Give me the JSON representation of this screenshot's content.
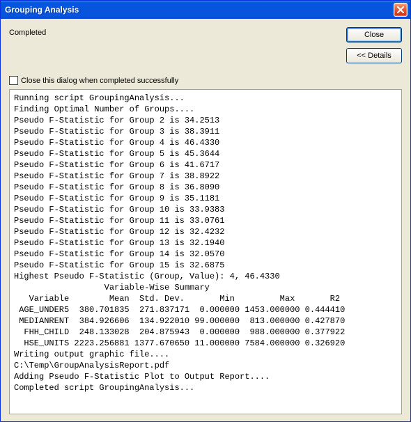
{
  "titlebar": {
    "title": "Grouping Analysis"
  },
  "status": "Completed",
  "buttons": {
    "close": "Close",
    "details": "<< Details"
  },
  "checkbox": {
    "label": "Close this dialog when completed successfully",
    "checked": false
  },
  "output_lines": [
    "Running script GroupingAnalysis...",
    "Finding Optimal Number of Groups....",
    "Pseudo F-Statistic for Group 2 is 34.2513",
    "Pseudo F-Statistic for Group 3 is 38.3911",
    "Pseudo F-Statistic for Group 4 is 46.4330",
    "Pseudo F-Statistic for Group 5 is 45.3644",
    "Pseudo F-Statistic for Group 6 is 41.6717",
    "Pseudo F-Statistic for Group 7 is 38.8922",
    "Pseudo F-Statistic for Group 8 is 36.8090",
    "Pseudo F-Statistic for Group 9 is 35.1181",
    "Pseudo F-Statistic for Group 10 is 33.9383",
    "Pseudo F-Statistic for Group 11 is 33.0761",
    "Pseudo F-Statistic for Group 12 is 32.4232",
    "Pseudo F-Statistic for Group 13 is 32.1940",
    "Pseudo F-Statistic for Group 14 is 32.0570",
    "Pseudo F-Statistic for Group 15 is 32.6875",
    "",
    "Highest Pseudo F-Statistic (Group, Value): 4, 46.4330",
    "",
    "                  Variable-Wise Summary",
    "   Variable        Mean  Std. Dev.       Min         Max       R2",
    " AGE_UNDER5  380.701835  271.837171  0.000000 1453.000000 0.444410",
    " MEDIANRENT  384.926606  134.922010 99.000000  813.000000 0.427870",
    "  FHH_CHILD  248.133028  204.875943  0.000000  988.000000 0.377922",
    "  HSE_UNITS 2223.256881 1377.670650 11.000000 7584.000000 0.326920",
    "Writing output graphic file....",
    "C:\\Temp\\GroupAnalysisReport.pdf",
    "Adding Pseudo F-Statistic Plot to Output Report....",
    "Completed script GroupingAnalysis..."
  ],
  "chart_data": {
    "type": "table",
    "title": "Variable-Wise Summary",
    "columns": [
      "Variable",
      "Mean",
      "Std. Dev.",
      "Min",
      "Max",
      "R2"
    ],
    "rows": [
      {
        "Variable": "AGE_UNDER5",
        "Mean": 380.701835,
        "Std. Dev.": 271.837171,
        "Min": 0.0,
        "Max": 1453.0,
        "R2": 0.44441
      },
      {
        "Variable": "MEDIANRENT",
        "Mean": 384.926606,
        "Std. Dev.": 134.92201,
        "Min": 99.0,
        "Max": 813.0,
        "R2": 0.42787
      },
      {
        "Variable": "FHH_CHILD",
        "Mean": 248.133028,
        "Std. Dev.": 204.875943,
        "Min": 0.0,
        "Max": 988.0,
        "R2": 0.377922
      },
      {
        "Variable": "HSE_UNITS",
        "Mean": 2223.256881,
        "Std. Dev.": 1377.67065,
        "Min": 11.0,
        "Max": 7584.0,
        "R2": 0.32692
      }
    ],
    "pseudo_f": [
      {
        "group": 2,
        "value": 34.2513
      },
      {
        "group": 3,
        "value": 38.3911
      },
      {
        "group": 4,
        "value": 46.433
      },
      {
        "group": 5,
        "value": 45.3644
      },
      {
        "group": 6,
        "value": 41.6717
      },
      {
        "group": 7,
        "value": 38.8922
      },
      {
        "group": 8,
        "value": 36.809
      },
      {
        "group": 9,
        "value": 35.1181
      },
      {
        "group": 10,
        "value": 33.9383
      },
      {
        "group": 11,
        "value": 33.0761
      },
      {
        "group": 12,
        "value": 32.4232
      },
      {
        "group": 13,
        "value": 32.194
      },
      {
        "group": 14,
        "value": 32.057
      },
      {
        "group": 15,
        "value": 32.6875
      }
    ],
    "highest_pseudo_f": {
      "group": 4,
      "value": 46.433
    },
    "output_path": "C:\\Temp\\GroupAnalysisReport.pdf"
  }
}
